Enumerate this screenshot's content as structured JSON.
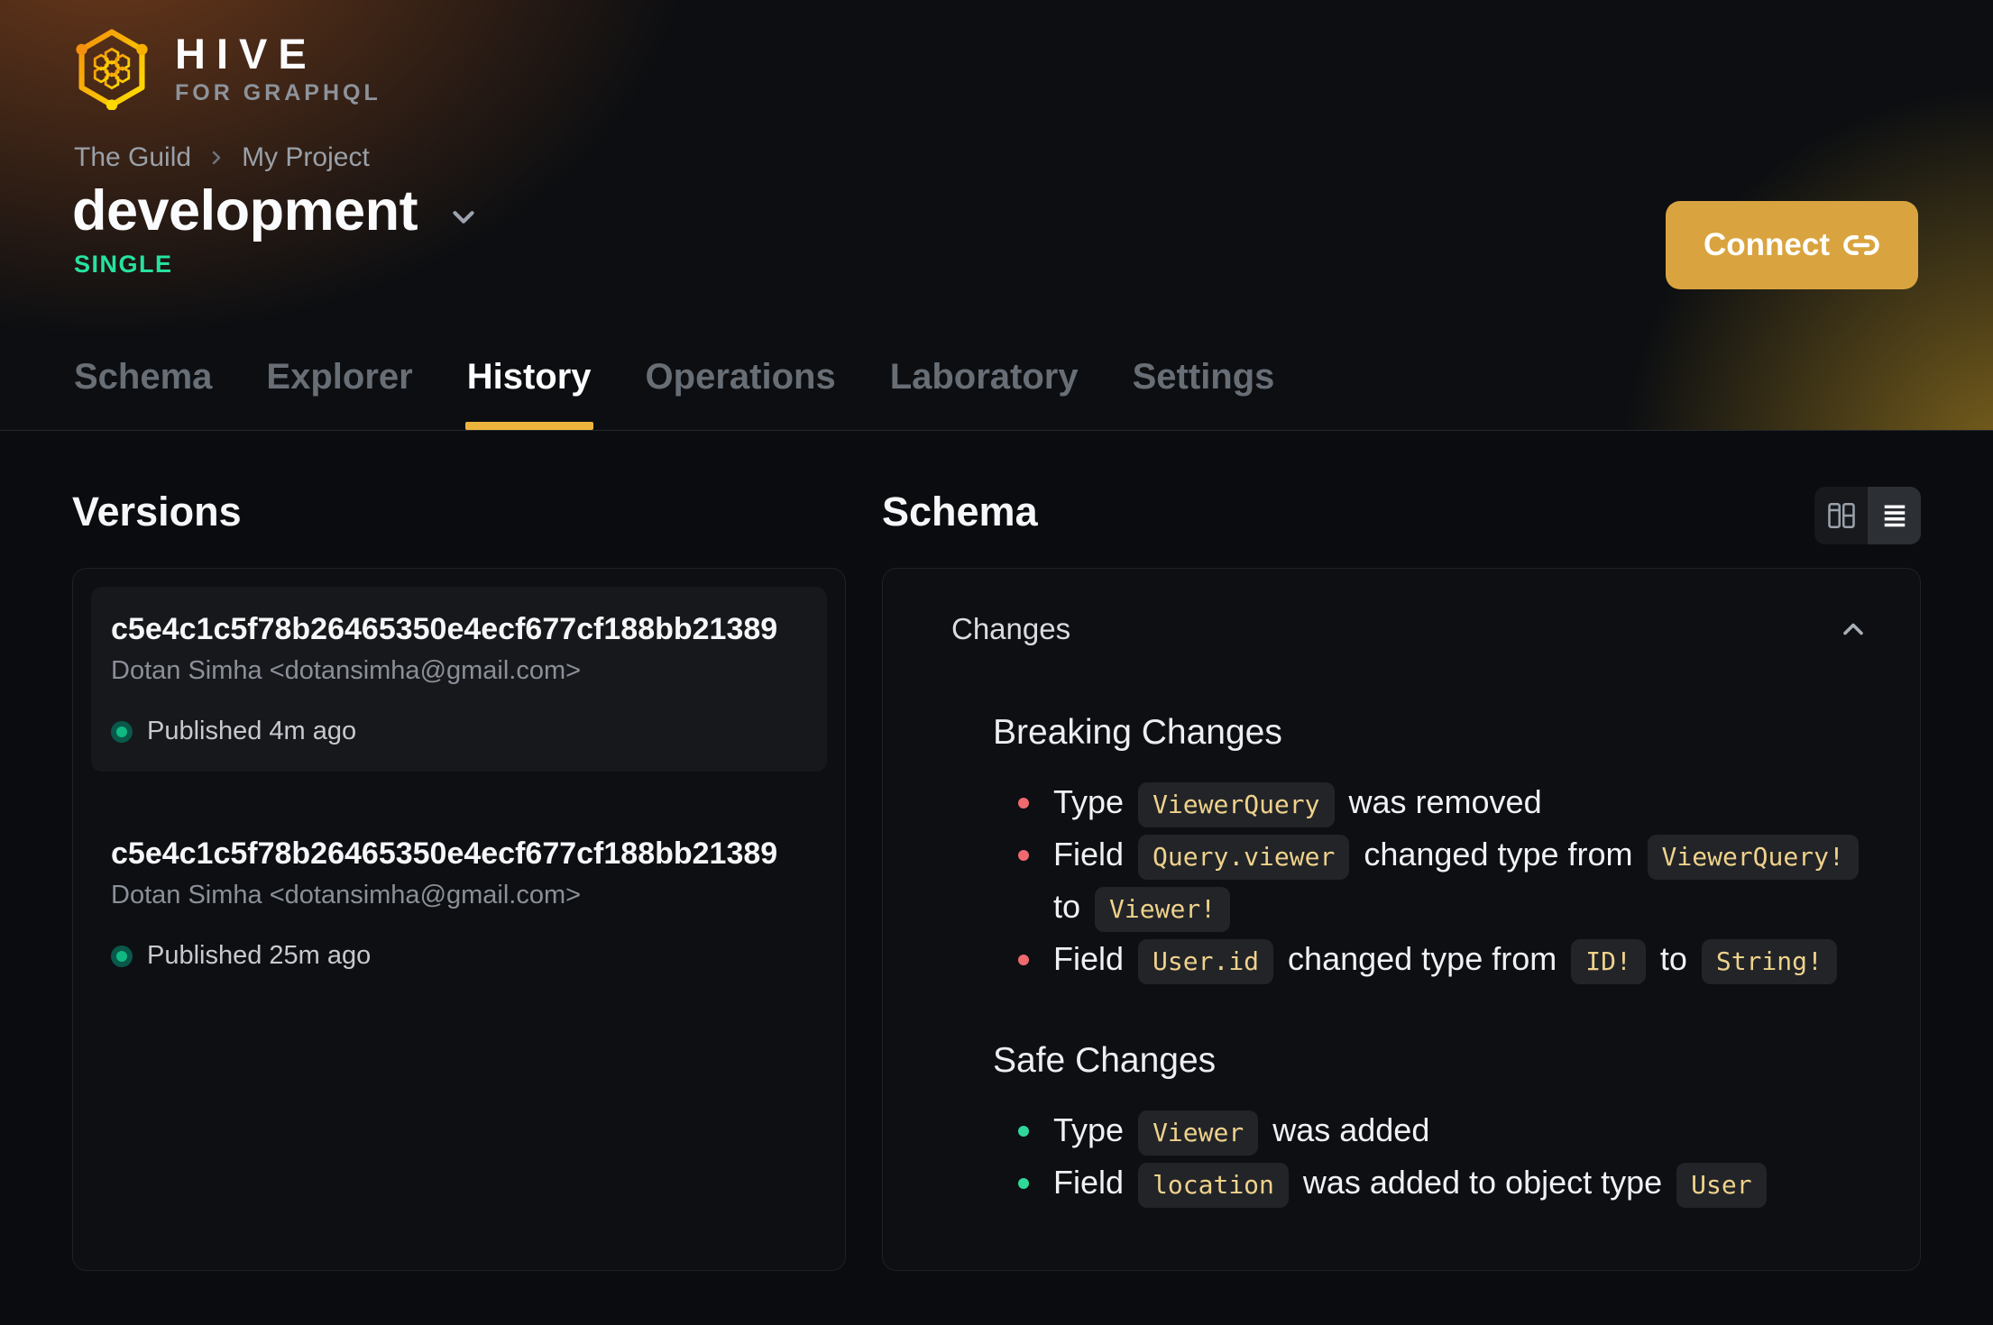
{
  "brand": {
    "name": "HIVE",
    "tagline": "FOR GRAPHQL"
  },
  "breadcrumb": [
    "The Guild",
    "My Project"
  ],
  "project": {
    "name": "development",
    "badge": "SINGLE"
  },
  "connect": {
    "label": "Connect"
  },
  "tabs": [
    {
      "label": "Schema",
      "active": false
    },
    {
      "label": "Explorer",
      "active": false
    },
    {
      "label": "History",
      "active": true
    },
    {
      "label": "Operations",
      "active": false
    },
    {
      "label": "Laboratory",
      "active": false
    },
    {
      "label": "Settings",
      "active": false
    }
  ],
  "versions": {
    "title": "Versions",
    "items": [
      {
        "hash": "c5e4c1c5f78b26465350e4ecf677cf188bb21389",
        "author": "Dotan Simha <dotansimha@gmail.com>",
        "status": "Published 4m ago",
        "highlighted": true
      },
      {
        "hash": "c5e4c1c5f78b26465350e4ecf677cf188bb21389",
        "author": "Dotan Simha <dotansimha@gmail.com>",
        "status": "Published 25m ago",
        "highlighted": false
      }
    ]
  },
  "schema_panel": {
    "title": "Schema",
    "changes_label": "Changes",
    "view_modes": [
      "columns-view",
      "list-view"
    ],
    "sections": [
      {
        "title": "Breaking Changes",
        "kind": "breaking",
        "items": [
          [
            {
              "t": "text",
              "v": "Type"
            },
            {
              "t": "code",
              "v": "ViewerQuery"
            },
            {
              "t": "text",
              "v": "was removed"
            }
          ],
          [
            {
              "t": "text",
              "v": "Field"
            },
            {
              "t": "code",
              "v": "Query.viewer"
            },
            {
              "t": "text",
              "v": "changed type from"
            },
            {
              "t": "code",
              "v": "ViewerQuery!"
            },
            {
              "t": "text",
              "v": "to"
            },
            {
              "t": "code",
              "v": "Viewer!"
            }
          ],
          [
            {
              "t": "text",
              "v": "Field"
            },
            {
              "t": "code",
              "v": "User.id"
            },
            {
              "t": "text",
              "v": "changed type from"
            },
            {
              "t": "code",
              "v": "ID!"
            },
            {
              "t": "text",
              "v": "to"
            },
            {
              "t": "code",
              "v": "String!"
            }
          ]
        ]
      },
      {
        "title": "Safe Changes",
        "kind": "safe",
        "items": [
          [
            {
              "t": "text",
              "v": "Type"
            },
            {
              "t": "code",
              "v": "Viewer"
            },
            {
              "t": "text",
              "v": "was added"
            }
          ],
          [
            {
              "t": "text",
              "v": "Field"
            },
            {
              "t": "code",
              "v": "location"
            },
            {
              "t": "text",
              "v": "was added to object type"
            },
            {
              "t": "code",
              "v": "User"
            }
          ]
        ]
      }
    ]
  },
  "colors": {
    "accent_underline": "#edb43d",
    "connect_button": "#d9a43f",
    "badge_green": "#26e2a0",
    "breaking_bullet": "#ee6a70",
    "safe_bullet": "#2fd79a",
    "chip_text": "#efd28b",
    "published_dot": "#10b981"
  }
}
